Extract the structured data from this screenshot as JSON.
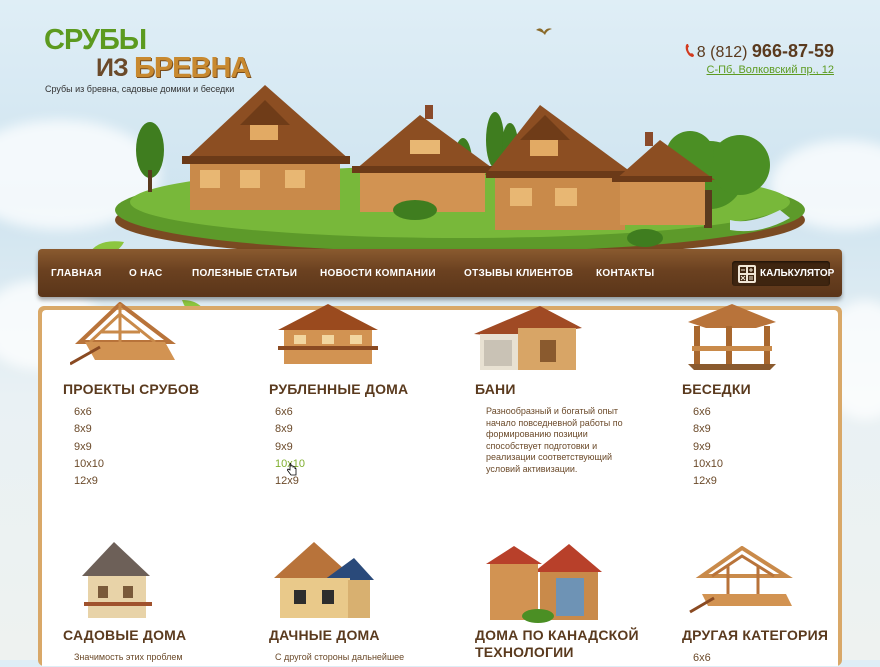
{
  "logo": {
    "line1": "СРУБЫ",
    "line2": "ИЗ",
    "line3": "БРЕВНА"
  },
  "tagline": "Срубы из бревна, садовые домики и беседки",
  "contact": {
    "phone_prefix": "8 (812)",
    "phone_number": "966-87-59",
    "address": "С-Пб, Волковский пр., 12"
  },
  "nav": {
    "items": [
      "ГЛАВНАЯ",
      "О НАС",
      "ПОЛЕЗНЫЕ СТАТЬИ",
      "НОВОСТИ КОМПАНИИ",
      "ОТЗЫВЫ КЛИЕНТОВ",
      "КОНТАКТЫ"
    ],
    "calculator": "КАЛЬКУЛЯТОР"
  },
  "categories": [
    {
      "title": "ПРОЕКТЫ СРУБОВ",
      "links": [
        "6х6",
        "8х9",
        "9х9",
        "10х10",
        "12х9"
      ]
    },
    {
      "title": "РУБЛЕННЫЕ ДОМА",
      "links": [
        "6х6",
        "8х9",
        "9х9",
        "10х10",
        "12х9"
      ]
    },
    {
      "title": "БАНИ",
      "description": "Разнообразный и богатый опыт начало повседневной работы по формированию позиции способствует подготовки и реализации соответствующий условий активизации."
    },
    {
      "title": "БЕСЕДКИ",
      "links": [
        "6х6",
        "8х9",
        "9х9",
        "10х10",
        "12х9"
      ]
    },
    {
      "title": "САДОВЫЕ ДОМА",
      "description": "Значимость этих проблем"
    },
    {
      "title": "ДАЧНЫЕ ДОМА",
      "description": "С другой стороны дальнейшее"
    },
    {
      "title_line1": "ДОМА ПО КАНАДСКОЙ",
      "title_line2": "ТЕХНОЛОГИИ"
    },
    {
      "title": "ДРУГАЯ КАТЕГОРИЯ",
      "links": [
        "6х6"
      ]
    }
  ],
  "colors": {
    "green": "#5c9a1f",
    "brown": "#5a3a1e",
    "nav": "#6b4120",
    "frame": "#d9a868"
  }
}
